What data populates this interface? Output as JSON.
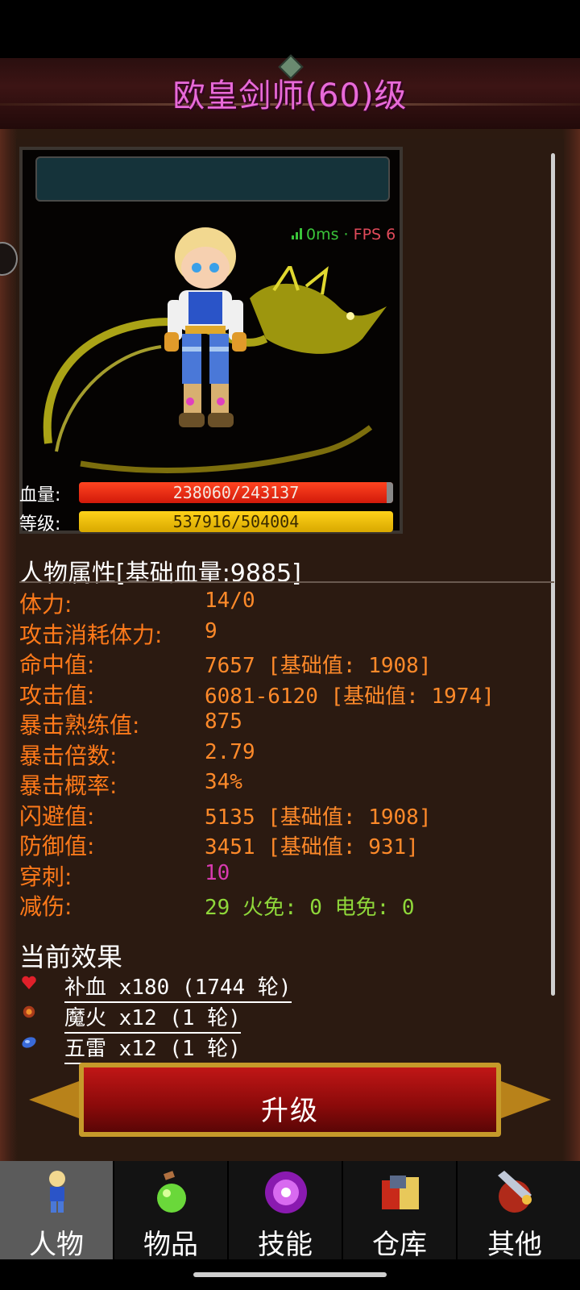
{
  "title": "欧皇剑师(60)级",
  "network": {
    "ping": "0ms",
    "separator": "·",
    "fps": "FPS 6"
  },
  "bars": {
    "hp_label": "血量:",
    "hp_text": "238060/243137",
    "hp_fraction": 0.979,
    "level_label": "等级:",
    "level_text": "537916/504004",
    "level_fraction": 1.0
  },
  "attributes": {
    "header": "人物属性[基础血量:9885]",
    "rows": [
      {
        "label": "体力:",
        "value": "14/0"
      },
      {
        "label": "攻击消耗体力:",
        "value": "9"
      },
      {
        "label": "命中值:",
        "value": "7657 [基础值: 1908]"
      },
      {
        "label": "攻击值:",
        "value": "6081-6120 [基础值: 1974]"
      },
      {
        "label": "暴击熟练值:",
        "value": "875"
      },
      {
        "label": "暴击倍数:",
        "value": "2.79"
      },
      {
        "label": "暴击概率:",
        "value": "34%"
      },
      {
        "label": "闪避值:",
        "value": "5135 [基础值: 1908]"
      },
      {
        "label": "防御值:",
        "value": "3451 [基础值: 931]"
      },
      {
        "label": "穿刺:",
        "value": "10"
      },
      {
        "label": "减伤:",
        "value": "29 火免: 0 电免: 0"
      }
    ]
  },
  "effects": {
    "header": "当前效果",
    "items": [
      {
        "text": "补血 x180 (1744 轮)",
        "icon": "heart-icon",
        "color": "#e0202a"
      },
      {
        "text": "魔火 x12 (1 轮)",
        "icon": "fire-icon",
        "color": "#d8602a"
      },
      {
        "text": "五雷 x12 (1 轮)",
        "icon": "thunder-icon",
        "color": "#3a6ad8"
      }
    ]
  },
  "upgrade_button": "升级",
  "nav": [
    {
      "label": "人物",
      "icon": "character-icon",
      "active": true
    },
    {
      "label": "物品",
      "icon": "potion-icon",
      "active": false
    },
    {
      "label": "技能",
      "icon": "skill-orb-icon",
      "active": false
    },
    {
      "label": "仓库",
      "icon": "storage-icon",
      "active": false
    },
    {
      "label": "其他",
      "icon": "other-icon",
      "active": false
    }
  ],
  "colors": {
    "title": "#e86ad8",
    "stat_label": "#ff7a1a",
    "hp_bar": "#e8261a",
    "exp_bar": "#f2c40a",
    "pierce": "#d83ab0",
    "resist": "#8fd83a"
  }
}
